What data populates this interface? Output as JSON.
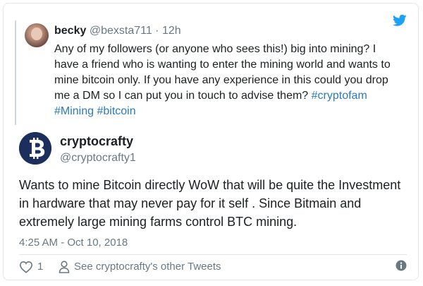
{
  "quoted_tweet": {
    "name": "becky",
    "handle": "@bexsta711",
    "separator": " · ",
    "time": "12h",
    "text_parts": {
      "body": "Any of my followers (or anyone who sees this!) big into mining? I have a friend who is wanting to enter the mining world and wants to mine bitcoin only. If you have any experience in this could you drop me a DM so I can put you in touch to advise them? ",
      "hashtag_1": "#cryptofam",
      "hashtag_2": "#Mining",
      "hashtag_3": "#bitcoin"
    }
  },
  "main_tweet": {
    "name": "cryptocrafty",
    "handle": "@cryptocrafty1",
    "text": "Wants to mine Bitcoin directly WoW that will be quite the Investment in hardware that may never pay for it self . Since Bitmain and extremely large mining farms control BTC mining.",
    "timestamp": "4:25 AM - Oct 10, 2018",
    "like_count": "1",
    "other_tweets_link": "See cryptocrafty's other Tweets"
  },
  "icons": {
    "twitter_bird": "twitter-bird-icon",
    "heart": "heart-icon",
    "person": "person-icon",
    "info": "info-icon",
    "bitcoin": "bitcoin-icon"
  },
  "colors": {
    "link_blue": "#2b7bb9",
    "twitter_blue": "#1da1f2",
    "muted_gray": "#697882",
    "avatar_navy": "#1c2e5e"
  }
}
